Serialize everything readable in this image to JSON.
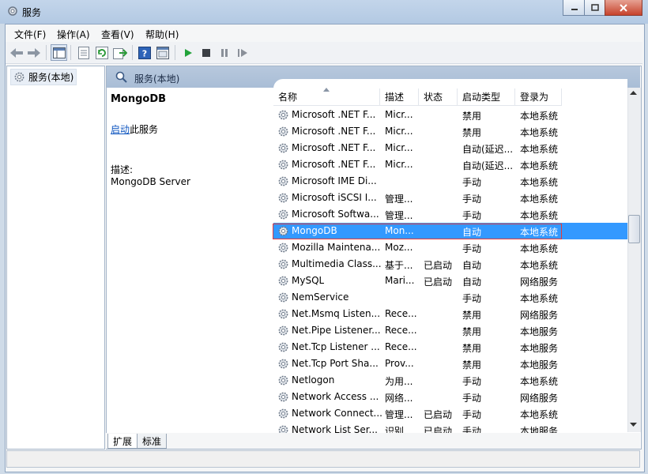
{
  "window": {
    "title": "服务"
  },
  "menu": [
    "文件(F)",
    "操作(A)",
    "查看(V)",
    "帮助(H)"
  ],
  "toolbar_icons": [
    "back-icon",
    "forward-icon",
    "console-tree-icon",
    "properties-icon",
    "refresh-icon",
    "export-icon",
    "help-icon",
    "view-icon",
    "play-icon",
    "stop-icon",
    "pause-icon",
    "restart-icon"
  ],
  "tree": {
    "root_label": "服务(本地)"
  },
  "pane": {
    "header": "服务(本地)",
    "service_name": "MongoDB",
    "start_link": "启动",
    "start_suffix": "此服务",
    "desc_label": "描述:",
    "desc_value": "MongoDB Server"
  },
  "columns": [
    "名称",
    "描述",
    "状态",
    "启动类型",
    "登录为"
  ],
  "rows": [
    {
      "name": "Microsoft .NET F...",
      "desc": "Micr...",
      "status": "",
      "startup": "禁用",
      "logon": "本地系统"
    },
    {
      "name": "Microsoft .NET F...",
      "desc": "Micr...",
      "status": "",
      "startup": "禁用",
      "logon": "本地系统"
    },
    {
      "name": "Microsoft .NET F...",
      "desc": "Micr...",
      "status": "",
      "startup": "自动(延迟...",
      "logon": "本地系统"
    },
    {
      "name": "Microsoft .NET F...",
      "desc": "Micr...",
      "status": "",
      "startup": "自动(延迟...",
      "logon": "本地系统"
    },
    {
      "name": "Microsoft IME Di...",
      "desc": "",
      "status": "",
      "startup": "手动",
      "logon": "本地系统"
    },
    {
      "name": "Microsoft iSCSI I...",
      "desc": "管理...",
      "status": "",
      "startup": "手动",
      "logon": "本地系统"
    },
    {
      "name": "Microsoft Softwa...",
      "desc": "管理...",
      "status": "",
      "startup": "手动",
      "logon": "本地系统"
    },
    {
      "name": "MongoDB",
      "desc": "Mon...",
      "status": "",
      "startup": "自动",
      "logon": "本地系统",
      "selected": true
    },
    {
      "name": "Mozilla Maintena...",
      "desc": "Moz...",
      "status": "",
      "startup": "手动",
      "logon": "本地系统"
    },
    {
      "name": "Multimedia Class...",
      "desc": "基于...",
      "status": "已启动",
      "startup": "自动",
      "logon": "本地系统"
    },
    {
      "name": "MySQL",
      "desc": "Mari...",
      "status": "已启动",
      "startup": "自动",
      "logon": "网络服务"
    },
    {
      "name": "NemService",
      "desc": "",
      "status": "",
      "startup": "手动",
      "logon": "本地系统"
    },
    {
      "name": "Net.Msmq Listen...",
      "desc": "Rece...",
      "status": "",
      "startup": "禁用",
      "logon": "网络服务"
    },
    {
      "name": "Net.Pipe Listener...",
      "desc": "Rece...",
      "status": "",
      "startup": "禁用",
      "logon": "本地服务"
    },
    {
      "name": "Net.Tcp Listener ...",
      "desc": "Rece...",
      "status": "",
      "startup": "禁用",
      "logon": "本地服务"
    },
    {
      "name": "Net.Tcp Port Sha...",
      "desc": "Prov...",
      "status": "",
      "startup": "禁用",
      "logon": "本地服务"
    },
    {
      "name": "Netlogon",
      "desc": "为用...",
      "status": "",
      "startup": "手动",
      "logon": "本地系统"
    },
    {
      "name": "Network Access ...",
      "desc": "网络...",
      "status": "",
      "startup": "手动",
      "logon": "网络服务"
    },
    {
      "name": "Network Connect...",
      "desc": "管理...",
      "status": "已启动",
      "startup": "手动",
      "logon": "本地系统"
    },
    {
      "name": "Network List Ser...",
      "desc": "识别...",
      "status": "已启动",
      "startup": "手动",
      "logon": "本地服务"
    }
  ],
  "tabs": [
    "扩展",
    "标准"
  ]
}
